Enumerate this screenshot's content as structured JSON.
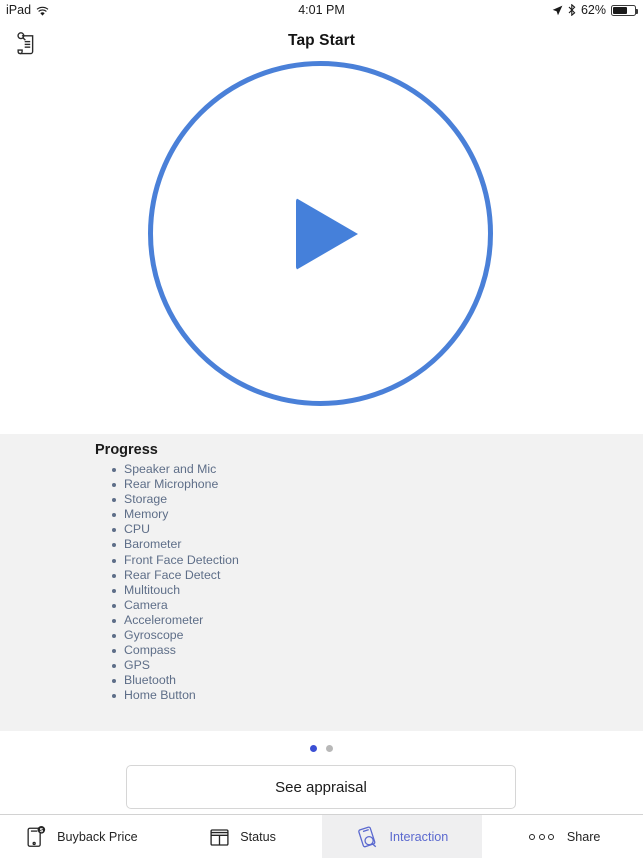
{
  "status_bar": {
    "device": "iPad",
    "wifi_icon": "wifi-icon",
    "time": "4:01 PM",
    "location_icon": "location-arrow-icon",
    "bluetooth_icon": "bluetooth-icon",
    "battery_percent": "62%",
    "battery_icon": "battery-icon"
  },
  "nav": {
    "title": "Tap Start",
    "left_icon": "appraisal-document-icon"
  },
  "hero": {
    "play_icon": "play-icon",
    "circle_color": "#4a80d8",
    "play_color": "#4580da"
  },
  "progress": {
    "title": "Progress",
    "items": [
      "Speaker and Mic",
      "Rear Microphone",
      "Storage",
      "Memory",
      "CPU",
      "Barometer",
      "Front Face Detection",
      "Rear Face Detect",
      "Multitouch",
      "Camera",
      "Accelerometer",
      "Gyroscope",
      "Compass",
      "GPS",
      "Bluetooth",
      "Home Button"
    ]
  },
  "pager": {
    "total": 2,
    "active_index": 0,
    "active_color": "#3b4fd4",
    "inactive_color": "#b8b8b8"
  },
  "primary_button": {
    "label": "See appraisal"
  },
  "tabbar": {
    "selected_color": "#5b69cf",
    "items": [
      {
        "label": "Buyback Price",
        "icon": "phone-dollar-icon",
        "selected": false
      },
      {
        "label": "Status",
        "icon": "layout-grid-icon",
        "selected": false
      },
      {
        "label": "Interaction",
        "icon": "device-search-icon",
        "selected": true
      },
      {
        "label": "Share",
        "icon": "three-dots-icon",
        "selected": false
      }
    ]
  }
}
